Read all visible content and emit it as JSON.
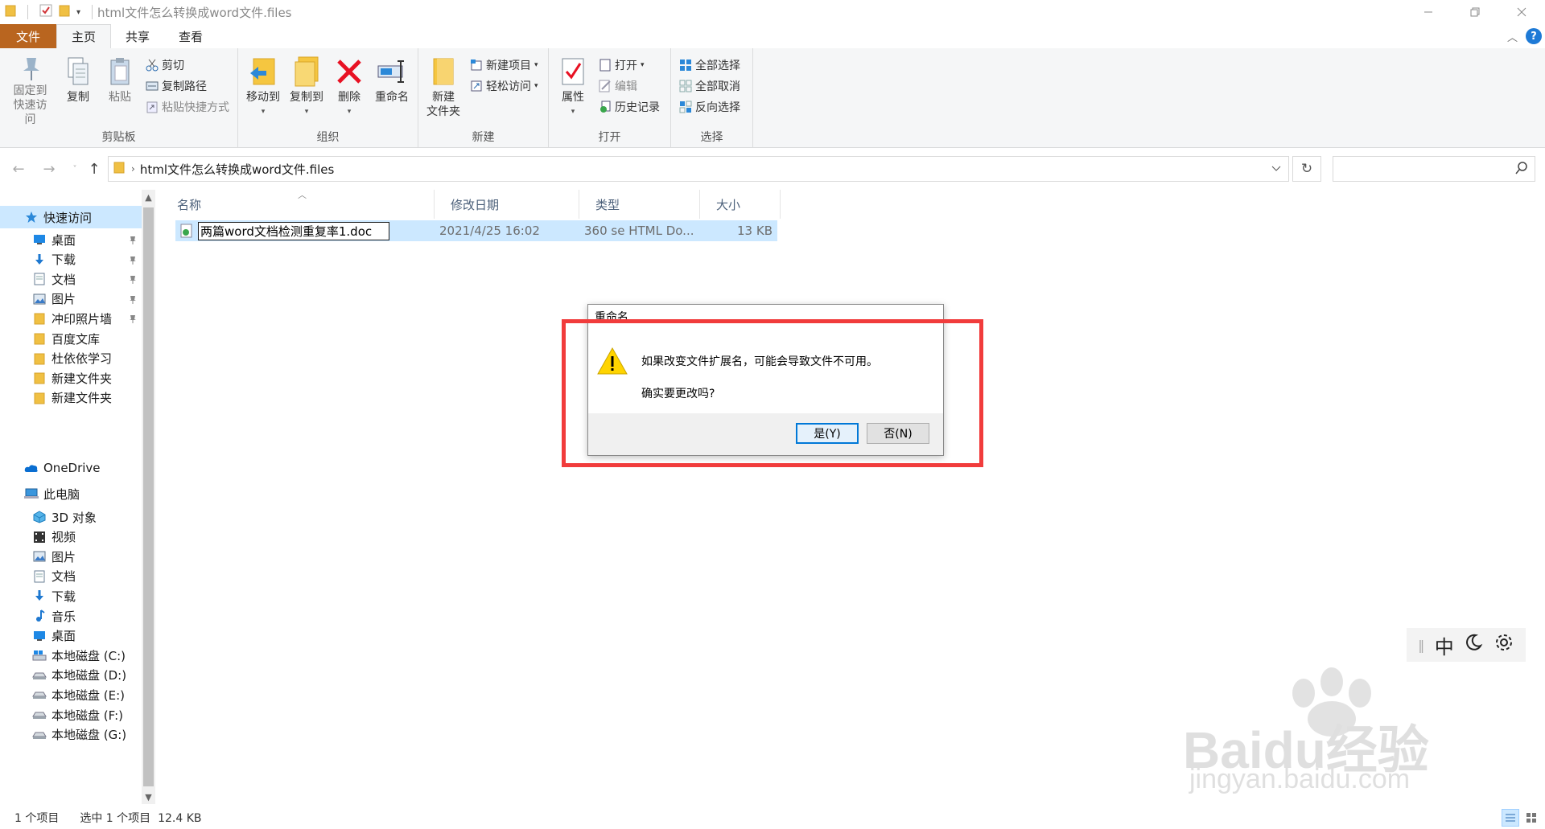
{
  "window": {
    "title": "html文件怎么转换成word文件.files",
    "controls": [
      "minimize",
      "restore",
      "close"
    ]
  },
  "ribbon_tabs": [
    {
      "label": "文件",
      "active": false
    },
    {
      "label": "主页",
      "active": true
    },
    {
      "label": "共享",
      "active": false
    },
    {
      "label": "查看",
      "active": false
    }
  ],
  "ribbon": {
    "clipboard": {
      "label": "剪贴板",
      "pin": "固定到\n快速访问",
      "pin_line1": "固定到",
      "pin_line2": "快速访问",
      "copy": "复制",
      "paste": "粘贴",
      "cut": "剪切",
      "copy_path": "复制路径",
      "paste_shortcut": "粘贴快捷方式"
    },
    "organize": {
      "label": "组织",
      "move_to": "移动到",
      "copy_to": "复制到",
      "delete": "删除",
      "rename": "重命名"
    },
    "new": {
      "label": "新建",
      "new_folder_line1": "新建",
      "new_folder_line2": "文件夹",
      "new_item": "新建项目",
      "easy_access": "轻松访问"
    },
    "open": {
      "label": "打开",
      "properties": "属性",
      "open": "打开",
      "edit": "编辑",
      "history": "历史记录"
    },
    "select": {
      "label": "选择",
      "select_all": "全部选择",
      "select_none": "全部取消",
      "invert": "反向选择"
    }
  },
  "address": {
    "path": "html文件怎么转换成word文件.files",
    "search_placeholder": ""
  },
  "nav_pane": {
    "quick_access": "快速访问",
    "quick_items": [
      {
        "label": "桌面",
        "icon": "desktop-icon",
        "pinned": true
      },
      {
        "label": "下载",
        "icon": "download-icon",
        "pinned": true
      },
      {
        "label": "文档",
        "icon": "document-icon",
        "pinned": true
      },
      {
        "label": "图片",
        "icon": "pictures-icon",
        "pinned": true
      },
      {
        "label": "冲印照片墙",
        "icon": "folder-icon",
        "pinned": true
      },
      {
        "label": "百度文库",
        "icon": "folder-icon",
        "pinned": false
      },
      {
        "label": "杜依依学习",
        "icon": "folder-icon",
        "pinned": false
      },
      {
        "label": "新建文件夹",
        "icon": "folder-icon",
        "pinned": false
      },
      {
        "label": "新建文件夹",
        "icon": "folder-icon",
        "pinned": false
      }
    ],
    "onedrive": "OneDrive",
    "this_pc": "此电脑",
    "pc_items": [
      {
        "label": "3D 对象",
        "icon": "3d-objects-icon"
      },
      {
        "label": "视频",
        "icon": "video-icon"
      },
      {
        "label": "图片",
        "icon": "pictures-icon"
      },
      {
        "label": "文档",
        "icon": "document-icon"
      },
      {
        "label": "下载",
        "icon": "download-icon"
      },
      {
        "label": "音乐",
        "icon": "music-icon"
      },
      {
        "label": "桌面",
        "icon": "desktop-icon"
      },
      {
        "label": "本地磁盘 (C:)",
        "icon": "system-drive-icon"
      },
      {
        "label": "本地磁盘 (D:)",
        "icon": "drive-icon"
      },
      {
        "label": "本地磁盘 (E:)",
        "icon": "drive-icon"
      },
      {
        "label": "本地磁盘 (F:)",
        "icon": "drive-icon"
      },
      {
        "label": "本地磁盘 (G:)",
        "icon": "drive-icon"
      }
    ]
  },
  "file_list": {
    "columns": [
      "名称",
      "修改日期",
      "类型",
      "大小"
    ],
    "rows": [
      {
        "name": "两篇word文档检测重复率1.doc",
        "modified": "2021/4/25 16:02",
        "type": "360 se HTML Do...",
        "size": "13 KB",
        "selected": true,
        "renaming": true
      }
    ]
  },
  "dialog": {
    "title": "重命名",
    "message": "如果改变文件扩展名，可能会导致文件不可用。",
    "question": "确实要更改吗?",
    "yes": "是(Y)",
    "no": "否(N)"
  },
  "ime_toolbar": {
    "lang": "中",
    "icons": [
      "moon-icon",
      "gear-icon"
    ]
  },
  "watermark": {
    "brand": "Baidu经验",
    "url": "jingyan.baidu.com"
  },
  "status": {
    "count": "1 个项目",
    "selection": "选中 1 个项目  12.4 KB"
  },
  "colors": {
    "file_tab": "#b9651f",
    "selection": "#cce8ff",
    "highlight_frame": "#f13c3c",
    "accent": "#0078d7"
  }
}
